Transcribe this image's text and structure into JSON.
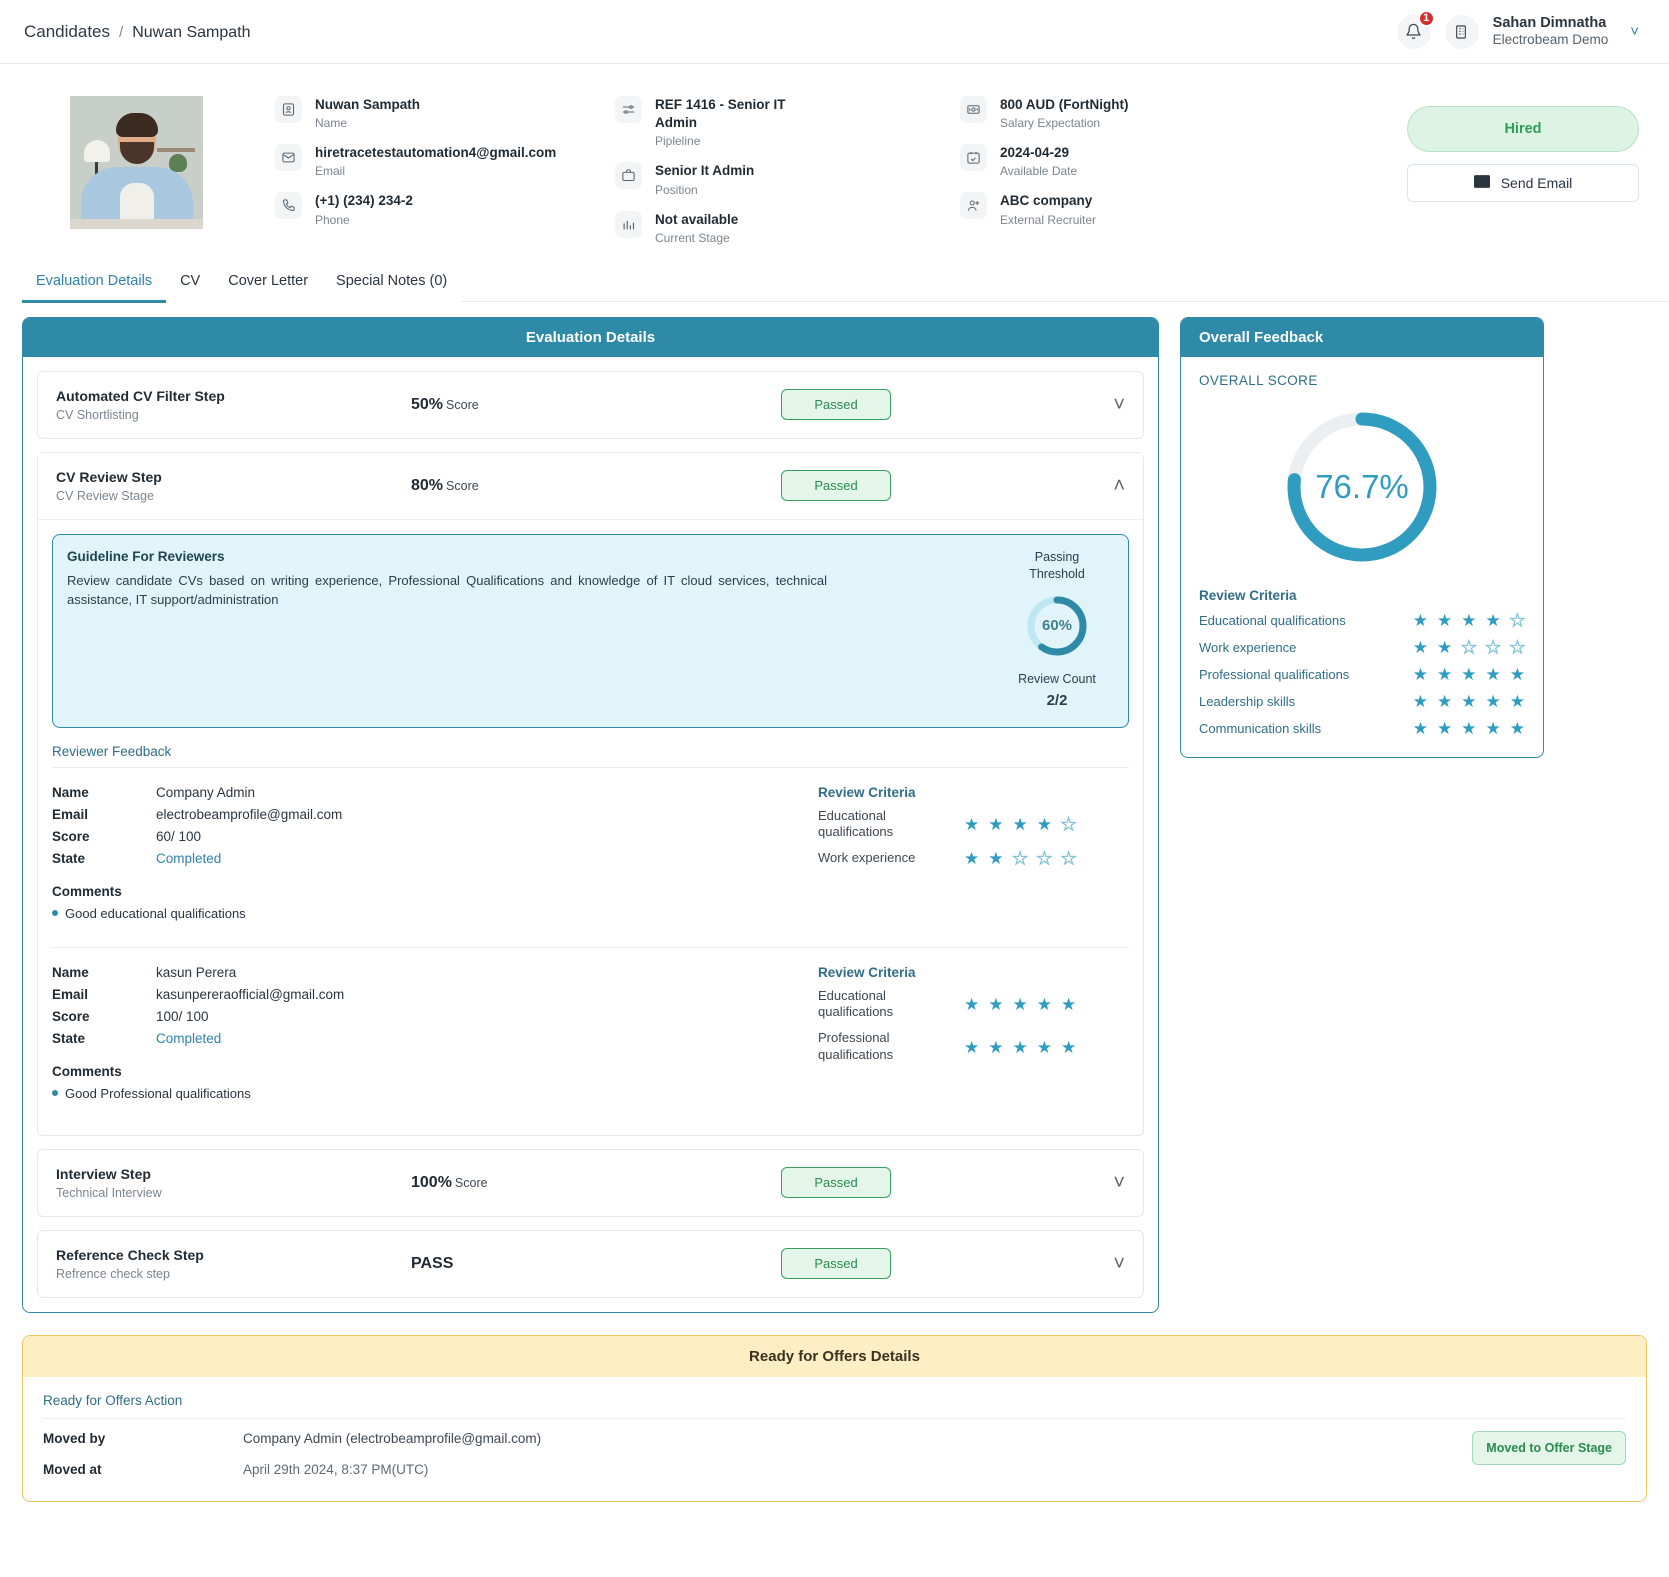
{
  "breadcrumb": {
    "root": "Candidates",
    "separator": "/",
    "leaf": "Nuwan Sampath"
  },
  "account": {
    "notification_count": "1",
    "user_name": "Sahan Dimnatha",
    "org_name": "Electrobeam Demo"
  },
  "profile": {
    "fields": [
      {
        "icon": "user-card-icon",
        "value": "Nuwan Sampath",
        "label": "Name"
      },
      {
        "icon": "envelope-icon",
        "value": "hiretracetestautomation4@gmail.com",
        "label": "Email"
      },
      {
        "icon": "phone-icon",
        "value": "(+1) (234) 234-2",
        "label": "Phone"
      },
      {
        "icon": "pipeline-icon",
        "value": "REF 1416 - Senior IT Admin",
        "label": "Pipleline"
      },
      {
        "icon": "briefcase-icon",
        "value": "Senior It Admin",
        "label": "Position"
      },
      {
        "icon": "chart-icon",
        "value": "Not available",
        "label": "Current Stage"
      },
      {
        "icon": "money-icon",
        "value": "800 AUD (FortNight)",
        "label": "Salary Expectation"
      },
      {
        "icon": "calendar-check-icon",
        "value": "2024-04-29",
        "label": "Available Date"
      },
      {
        "icon": "user-plus-icon",
        "value": "ABC company",
        "label": "External Recruiter"
      }
    ],
    "status_button": "Hired",
    "email_button": "Send Email"
  },
  "tabs": [
    {
      "label": "Evaluation Details",
      "active": true
    },
    {
      "label": "CV",
      "active": false
    },
    {
      "label": "Cover Letter",
      "active": false
    },
    {
      "label": "Special Notes (0)",
      "active": false
    }
  ],
  "evaluation": {
    "title": "Evaluation Details",
    "steps": [
      {
        "name": "Automated CV Filter Step",
        "sub": "CV Shortlisting",
        "score": "50%",
        "score_unit": "Score",
        "status": "Passed",
        "expanded": false
      },
      {
        "name": "CV Review Step",
        "sub": "CV Review Stage",
        "score": "80%",
        "score_unit": "Score",
        "status": "Passed",
        "expanded": true
      },
      {
        "name": "Interview Step",
        "sub": "Technical Interview",
        "score": "100%",
        "score_unit": "Score",
        "status": "Passed",
        "expanded": false
      },
      {
        "name": "Reference Check Step",
        "sub": "Refrence check step",
        "score": "PASS",
        "score_unit": "",
        "status": "Passed",
        "expanded": false
      }
    ],
    "guideline": {
      "heading": "Guideline For Reviewers",
      "body": "Review candidate CVs based on writing experience, Professional Qualifications and knowledge of IT cloud services, technical assistance, IT support/administration",
      "threshold_label_line1": "Passing",
      "threshold_label_line2": "Threshold",
      "threshold_value": "60%",
      "threshold_percent": 60,
      "review_count_label": "Review Count",
      "review_count": "2/2"
    },
    "reviewer_feedback_title": "Reviewer Feedback",
    "labels": {
      "name": "Name",
      "email": "Email",
      "score": "Score",
      "state": "State",
      "comments": "Comments",
      "review_criteria": "Review Criteria"
    },
    "reviewers": [
      {
        "name": "Company Admin",
        "email": "electrobeamprofile@gmail.com",
        "score": "60/ 100",
        "state": "Completed",
        "comments": [
          "Good educational qualifications"
        ],
        "criteria": [
          {
            "label": "Educational qualifications",
            "stars": 4,
            "max": 5
          },
          {
            "label": "Work experience",
            "stars": 2,
            "max": 5
          }
        ]
      },
      {
        "name": "kasun Perera",
        "email": "kasunpereraofficial@gmail.com",
        "score": "100/ 100",
        "state": "Completed",
        "comments": [
          "Good Professional qualifications"
        ],
        "criteria": [
          {
            "label": "Educational qualifications",
            "stars": 5,
            "max": 5
          },
          {
            "label": "Professional qualifications",
            "stars": 5,
            "max": 5
          }
        ]
      }
    ]
  },
  "overall_feedback": {
    "title": "Overall Feedback",
    "score_label": "OVERALL SCORE",
    "score_value": "76.7%",
    "score_percent": 76.7,
    "criteria_title": "Review Criteria",
    "criteria": [
      {
        "label": "Educational qualifications",
        "stars": 4,
        "max": 5
      },
      {
        "label": "Work experience",
        "stars": 2,
        "max": 5
      },
      {
        "label": "Professional qualifications",
        "stars": 5,
        "max": 5
      },
      {
        "label": "Leadership skills",
        "stars": 5,
        "max": 5
      },
      {
        "label": "Communication skills",
        "stars": 5,
        "max": 5
      }
    ]
  },
  "ready_for_offers": {
    "title": "Ready for Offers Details",
    "section_title": "Ready for Offers Action",
    "rows": [
      {
        "key": "Moved by",
        "value": "Company Admin (electrobeamprofile@gmail.com)"
      },
      {
        "key": "Moved at",
        "value": "April 29th 2024, 8:37 PM(UTC)"
      }
    ],
    "chip": "Moved to Offer Stage"
  },
  "colors": {
    "accent": "#2f8aa8",
    "star": "#2f9cc0",
    "pass": "#2c8a50",
    "warn": "#f0c75e"
  }
}
